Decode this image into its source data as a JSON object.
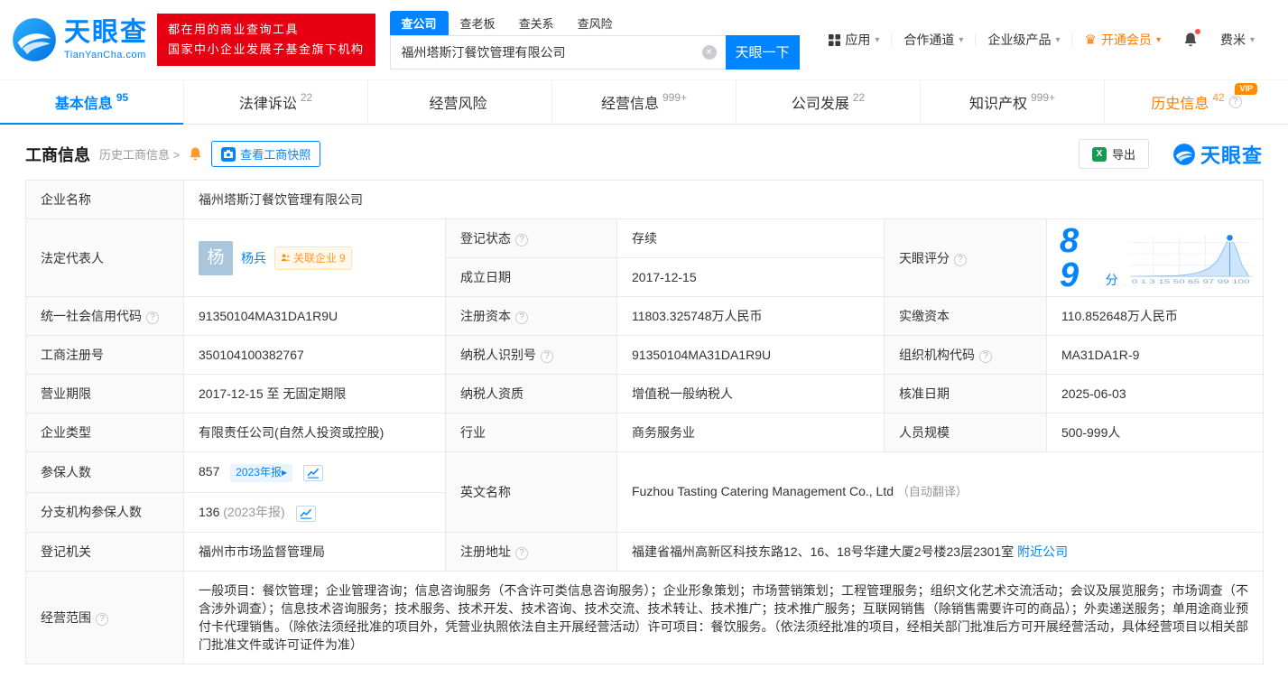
{
  "brand": {
    "name": "天眼查",
    "domain": "TianYanCha.com",
    "slogan1": "都在用的商业查询工具",
    "slogan2": "国家中小企业发展子基金旗下机构"
  },
  "icons": {
    "caret_down": "▾",
    "crown": "♛",
    "excel": "X",
    "clear": "×",
    "chevron": ">",
    "year_arrow": "▸",
    "help": "?"
  },
  "search": {
    "tabs": [
      {
        "label": "查公司"
      },
      {
        "label": "查老板"
      },
      {
        "label": "查关系"
      },
      {
        "label": "查风险"
      }
    ],
    "value": "福州塔斯汀餐饮管理有限公司",
    "button": "天眼一下"
  },
  "top_nav": {
    "apps": "应用",
    "partner": "合作通道",
    "enterprise": "企业级产品",
    "vip": "开通会员",
    "user": "费米"
  },
  "page_tabs": [
    {
      "label": "基本信息",
      "count": "95"
    },
    {
      "label": "法律诉讼",
      "count": "22"
    },
    {
      "label": "经营风险",
      "count": ""
    },
    {
      "label": "经营信息",
      "count": "999+"
    },
    {
      "label": "公司发展",
      "count": "22"
    },
    {
      "label": "知识产权",
      "count": "999+"
    },
    {
      "label": "历史信息",
      "count": "42",
      "badge": "VIP"
    }
  ],
  "section": {
    "title": "工商信息",
    "history": "历史工商信息",
    "snapshot": "查看工商快照",
    "export": "导出",
    "watermark": "天眼查"
  },
  "score_chart": {
    "score": "89",
    "unit": "分",
    "axis": "0 1 3 15 50 65 97 99 100"
  },
  "fields": {
    "company_name": {
      "label": "企业名称",
      "value": "福州塔斯汀餐饮管理有限公司"
    },
    "legal_rep": {
      "label": "法定代表人",
      "avatar": "杨",
      "name": "杨兵",
      "badge": "关联企业",
      "badge_count": "9"
    },
    "reg_status": {
      "label": "登记状态",
      "value": "存续"
    },
    "establish_date": {
      "label": "成立日期",
      "value": "2017-12-15"
    },
    "score": {
      "label": "天眼评分"
    },
    "credit_code": {
      "label": "统一社会信用代码",
      "value": "91350104MA31DA1R9U"
    },
    "reg_capital": {
      "label": "注册资本",
      "value": "11803.325748万人民币"
    },
    "paid_capital": {
      "label": "实缴资本",
      "value": "110.852648万人民币"
    },
    "reg_number": {
      "label": "工商注册号",
      "value": "350104100382767"
    },
    "taxpayer_id": {
      "label": "纳税人识别号",
      "value": "91350104MA31DA1R9U"
    },
    "org_code": {
      "label": "组织机构代码",
      "value": "MA31DA1R-9"
    },
    "business_term": {
      "label": "营业期限",
      "value": "2017-12-15 至 无固定期限"
    },
    "taxpayer_quality": {
      "label": "纳税人资质",
      "value": "增值税一般纳税人"
    },
    "approval_date": {
      "label": "核准日期",
      "value": "2025-06-03"
    },
    "company_type": {
      "label": "企业类型",
      "value": "有限责任公司(自然人投资或控股)"
    },
    "industry": {
      "label": "行业",
      "value": "商务服务业"
    },
    "staff_size": {
      "label": "人员规模",
      "value": "500-999人"
    },
    "insured_count": {
      "label": "参保人数",
      "value": "857",
      "badge": "2023年报"
    },
    "english_name": {
      "label": "英文名称",
      "value": "Fuzhou Tasting Catering Management Co., Ltd",
      "note": "（自动翻译）"
    },
    "branch_insured": {
      "label": "分支机构参保人数",
      "value": "136",
      "note": "(2023年报)"
    },
    "reg_authority": {
      "label": "登记机关",
      "value": "福州市市场监督管理局"
    },
    "reg_address": {
      "label": "注册地址",
      "value": "福建省福州高新区科技东路12、16、18号华建大厦2号楼23层2301室",
      "link": "附近公司"
    },
    "business_scope": {
      "label": "经营范围",
      "value": "一般项目：餐饮管理；企业管理咨询；信息咨询服务（不含许可类信息咨询服务）；企业形象策划；市场营销策划；工程管理服务；组织文化艺术交流活动；会议及展览服务；市场调查（不含涉外调查）；信息技术咨询服务；技术服务、技术开发、技术咨询、技术交流、技术转让、技术推广；技术推广服务；互联网销售（除销售需要许可的商品）；外卖递送服务；单用途商业预付卡代理销售。（除依法须经批准的项目外，凭营业执照依法自主开展经营活动）许可项目：餐饮服务。（依法须经批准的项目，经相关部门批准后方可开展经营活动，具体经营项目以相关部门批准文件或许可证件为准）"
    }
  }
}
